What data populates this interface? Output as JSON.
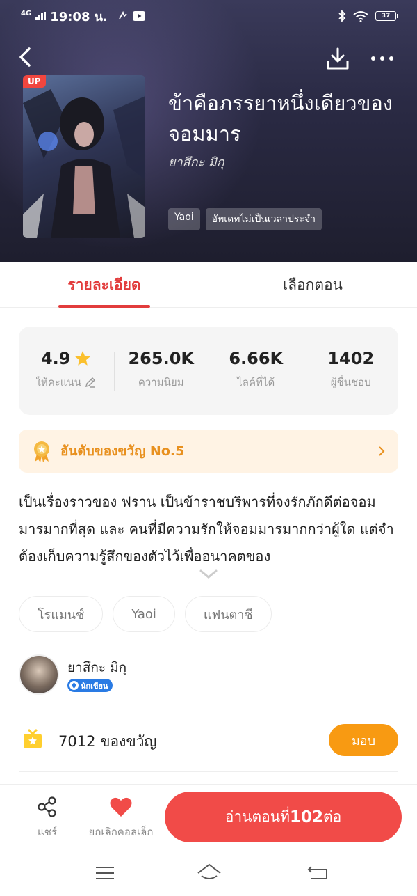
{
  "status_bar": {
    "network": "4G",
    "time": "19:08 น.",
    "battery": "37"
  },
  "book": {
    "badge": "UP",
    "title": "ข้าคือภรรยาหนึ่งเดียวของจอมมาร",
    "author": "ยาสึกะ มิกุ",
    "tags": [
      "Yaoi",
      "อัพเดทไม่เป็นเวลาประจำ"
    ]
  },
  "tabs": {
    "details": "รายละเอียด",
    "chapters": "เลือกตอน"
  },
  "stats": {
    "rating_value": "4.9",
    "rating_label": "ให้คะแนน",
    "popularity_value": "265.0K",
    "popularity_label": "ความนิยม",
    "likes_value": "6.66K",
    "likes_label": "ไลค์ที่ได้",
    "fans_value": "1402",
    "fans_label": "ผู้ชื่นชอบ"
  },
  "ranking": {
    "text": "อันดับของขวัญ No.5"
  },
  "synopsis": {
    "text": "เป็นเรื่องราวของ ฟราน เป็นข้าราชบริพารที่จงรักภักดีต่อจอมมารมากที่สุด และ คนที่มีความรักให้จอมมารมากกว่าผู้ใด แต่จำต้องเก็บความรู้สึกของตัวไว้เพื่ออนาคตของ"
  },
  "genres": [
    "โรแมนซ์",
    "Yaoi",
    "แฟนตาซี"
  ],
  "author_section": {
    "name": "ยาสึกะ มิกุ",
    "badge": "นักเขียน"
  },
  "gifts": {
    "text": "7012 ของขวัญ",
    "button": "มอบ"
  },
  "bottom_bar": {
    "share_label": "แชร์",
    "uncollect_label": "ยกเลิกคอลเล็ก",
    "read_prefix": "อ่านตอนที่",
    "read_number": "102",
    "read_suffix": "ต่อ"
  },
  "colors": {
    "accent": "#e23c3c",
    "read_button": "#f14b48",
    "gift_button": "#f89a12",
    "rank_text": "#e8901e",
    "writer_badge": "#2a7be4"
  }
}
